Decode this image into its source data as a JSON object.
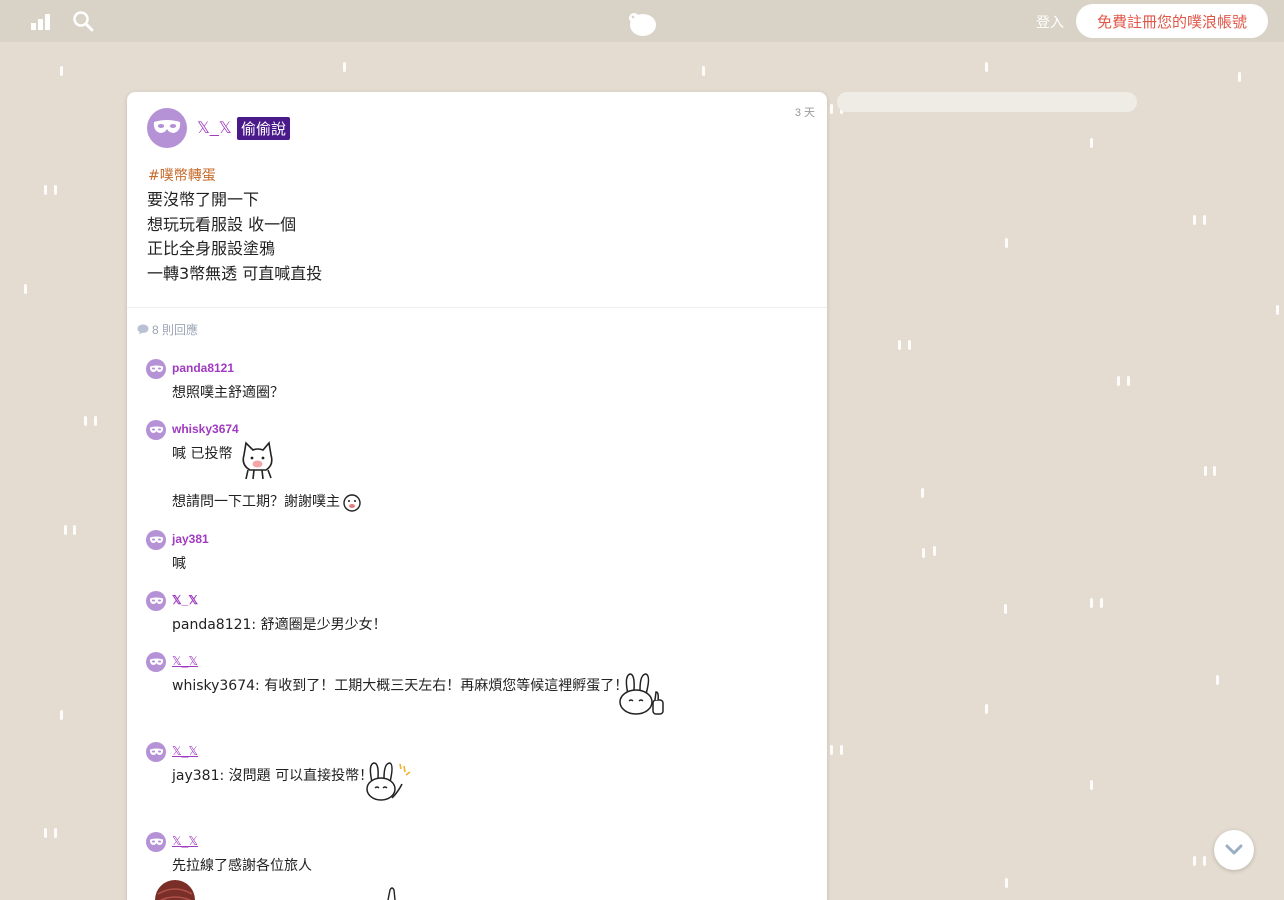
{
  "header": {
    "login_label": "登入",
    "signup_label": "免費註冊您的噗浪帳號"
  },
  "post": {
    "author": "𝕏_𝕏",
    "badge": "偷偷說",
    "time": "3 天",
    "hashtag": "#噗幣轉蛋",
    "body": "要沒幣了開一下\n想玩玩看服設 收一個\n正比全身服設塗鴉\n一轉3幣無透 可直喊直投"
  },
  "replies_label": "8 則回應",
  "replies": [
    {
      "name": "panda8121",
      "text": "想照噗主舒適圈？"
    },
    {
      "name": "whisky3674",
      "text": "喊 已投幣",
      "text2": "想請問一下工期？謝謝噗主"
    },
    {
      "name": "jay381",
      "text": "喊"
    },
    {
      "name": "𝕏_𝕏",
      "text": "panda8121: 舒適圈是少男少女！"
    },
    {
      "name": "𝕏_𝕏",
      "text": "whisky3674: 有收到了！工期大概三天左右！再麻煩您等候這裡孵蛋了！"
    },
    {
      "name": "𝕏_𝕏",
      "text": "jay381: 沒問題 可以直接投幣！"
    },
    {
      "name": "𝕏_𝕏",
      "text": "先拉線了感謝各位旅人"
    }
  ],
  "icons": [
    "chart-icon",
    "search-icon",
    "logo-icon",
    "mask-icon",
    "comment-icon",
    "chevron-down-icon"
  ],
  "colors": {
    "accent": "#a03ac0",
    "background": "#e4dcd0",
    "signup_text": "#e0584a",
    "badge": "#4b1a8a"
  }
}
